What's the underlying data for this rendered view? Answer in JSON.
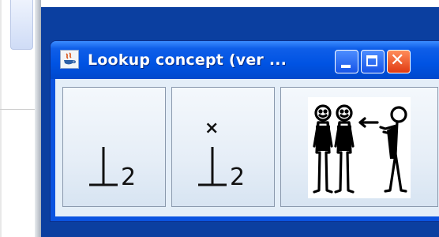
{
  "window": {
    "title": "Lookup concept (ver ...",
    "controls": [
      "minimize",
      "maximize",
      "close"
    ]
  },
  "concepts": [
    {
      "symbol": "⊥",
      "subscript": "2",
      "icon": "perpendicular-symbol-icon"
    },
    {
      "symbol": "⊥",
      "subscript": "2",
      "mark": "×",
      "icon": "perpendicular-x-symbol-icon"
    },
    {
      "icon": "people-pointing-pictogram-icon"
    }
  ],
  "colors": {
    "desktop": "#0b3fa0",
    "titlebar": "#0053e3",
    "close_button": "#e03a12",
    "content_bg": "#e4eef8"
  }
}
